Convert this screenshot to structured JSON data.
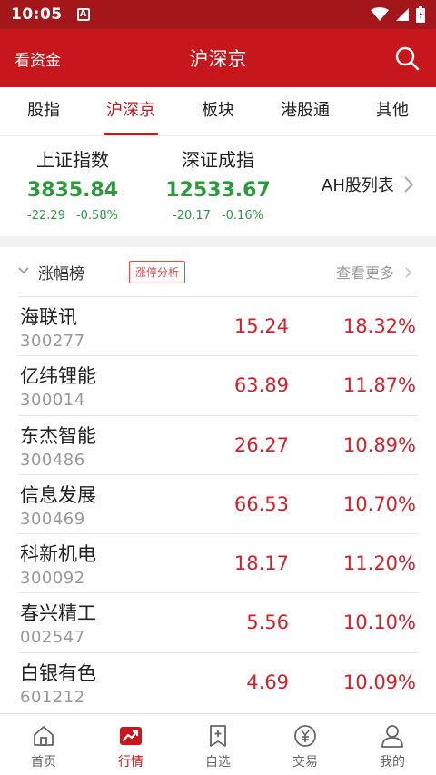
{
  "status_bar": {
    "time": "10:05",
    "notification_badge": "A"
  },
  "header": {
    "left_link": "看资金",
    "title": "沪深京"
  },
  "tabs": [
    {
      "label": "股指",
      "active": false
    },
    {
      "label": "沪深京",
      "active": true
    },
    {
      "label": "板块",
      "active": false
    },
    {
      "label": "港股通",
      "active": false
    },
    {
      "label": "其他",
      "active": false
    }
  ],
  "indices": [
    {
      "name": "上证指数",
      "value": "3835.84",
      "change": "-22.29",
      "change_pct": "-0.58%"
    },
    {
      "name": "深证成指",
      "value": "12533.67",
      "change": "-20.17",
      "change_pct": "-0.16%"
    }
  ],
  "ah_link": "AH股列表",
  "rank": {
    "title": "涨幅榜",
    "badge": "涨停分析",
    "more": "查看更多"
  },
  "stocks": [
    {
      "name": "海联讯",
      "code": "300277",
      "price": "15.24",
      "pct": "18.32%"
    },
    {
      "name": "亿纬锂能",
      "code": "300014",
      "price": "63.89",
      "pct": "11.87%"
    },
    {
      "name": "东杰智能",
      "code": "300486",
      "price": "26.27",
      "pct": "10.89%"
    },
    {
      "name": "信息发展",
      "code": "300469",
      "price": "66.53",
      "pct": "10.70%"
    },
    {
      "name": "科新机电",
      "code": "300092",
      "price": "18.17",
      "pct": "11.20%"
    },
    {
      "name": "春兴精工",
      "code": "002547",
      "price": "5.56",
      "pct": "10.10%"
    },
    {
      "name": "白银有色",
      "code": "601212",
      "price": "4.69",
      "pct": "10.09%"
    }
  ],
  "bottom_nav": [
    {
      "label": "首页",
      "icon": "home-icon",
      "active": false
    },
    {
      "label": "行情",
      "icon": "market-chart-icon",
      "active": true
    },
    {
      "label": "自选",
      "icon": "bookmark-add-icon",
      "active": false
    },
    {
      "label": "交易",
      "icon": "yuan-coin-icon",
      "active": false
    },
    {
      "label": "我的",
      "icon": "user-icon",
      "active": false
    }
  ],
  "colors": {
    "brand_red": "#c8161d",
    "up_red": "#d6212b",
    "down_green": "#2b9a3b"
  }
}
